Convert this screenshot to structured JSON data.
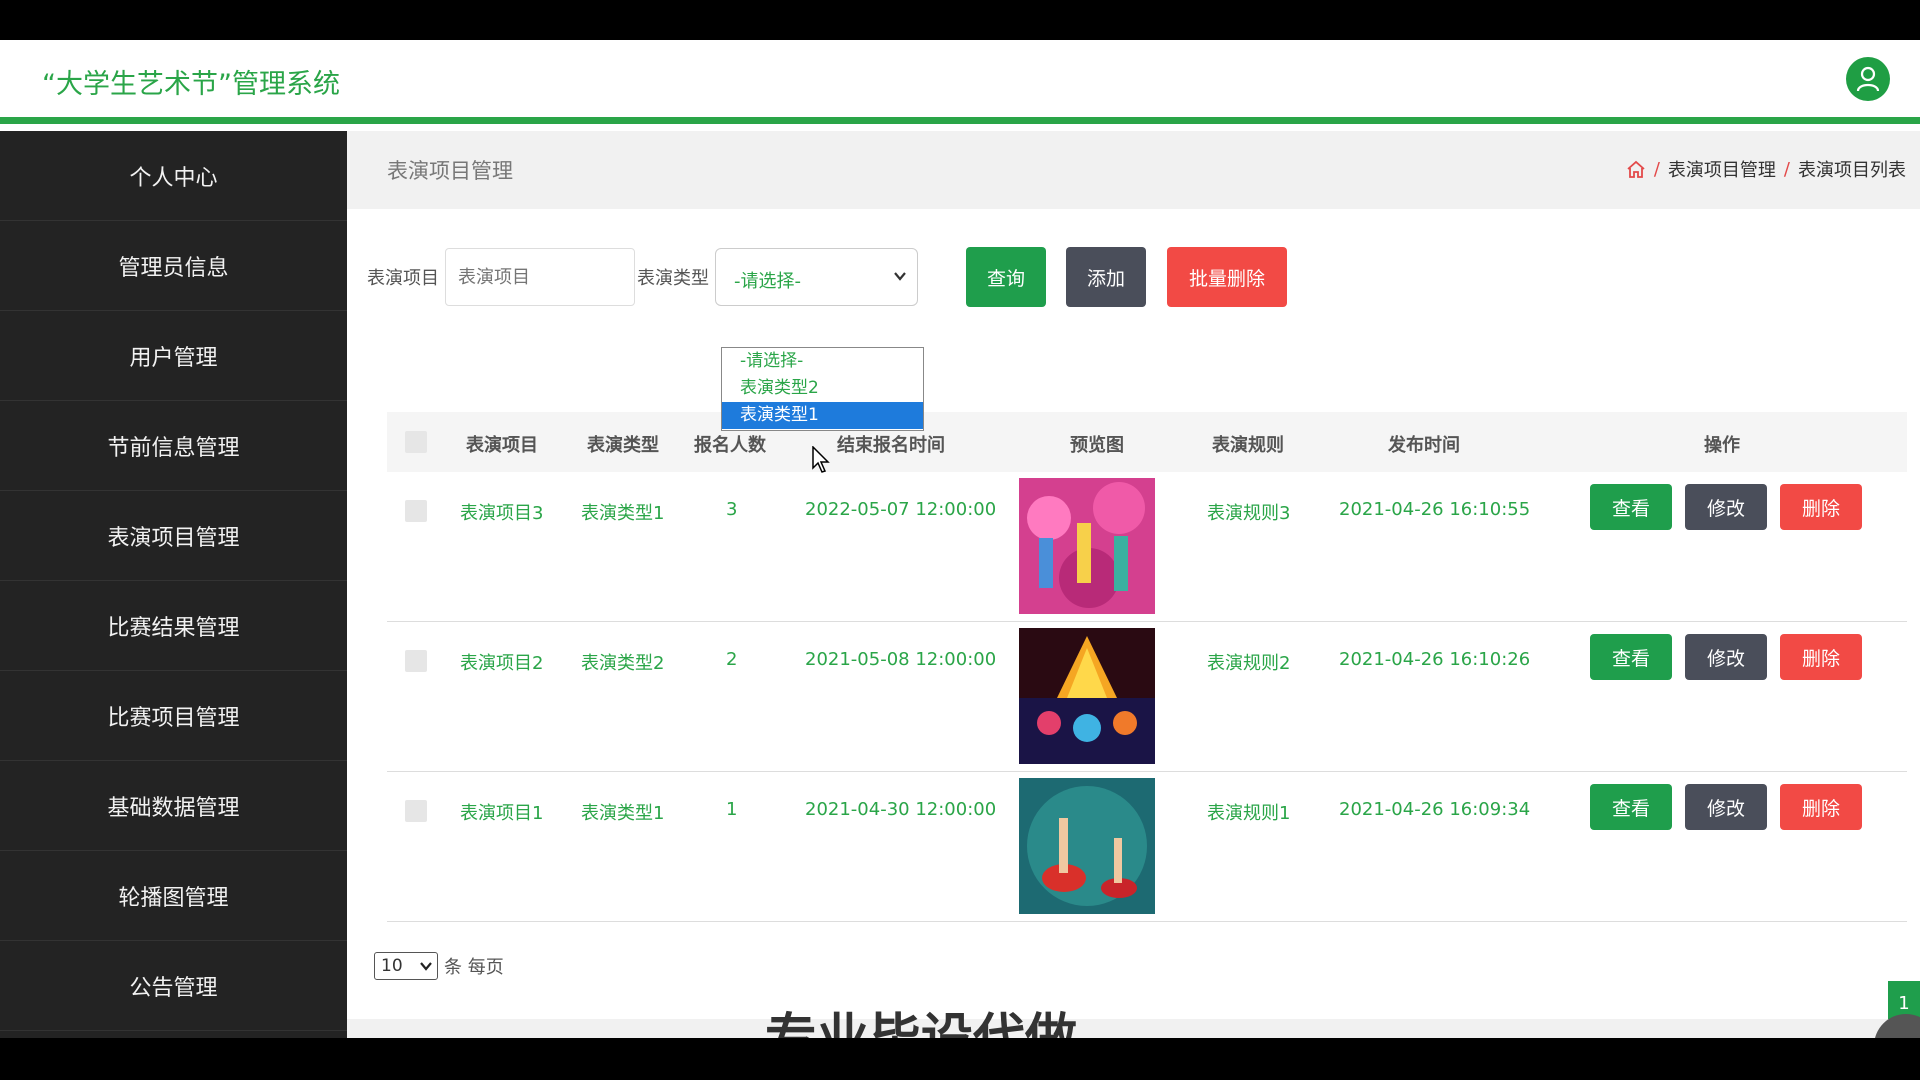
{
  "app": {
    "title": "“大学生艺术节”管理系统",
    "accent_color": "#2aa548"
  },
  "sidebar": {
    "items": [
      {
        "label": "个人中心"
      },
      {
        "label": "管理员信息"
      },
      {
        "label": "用户管理"
      },
      {
        "label": "节前信息管理"
      },
      {
        "label": "表演项目管理"
      },
      {
        "label": "比赛结果管理"
      },
      {
        "label": "比赛项目管理"
      },
      {
        "label": "基础数据管理"
      },
      {
        "label": "轮播图管理"
      },
      {
        "label": "公告管理"
      }
    ]
  },
  "page": {
    "title": "表演项目管理",
    "breadcrumb": [
      "表演项目管理",
      "表演项目列表"
    ],
    "breadcrumb_sep": "/"
  },
  "filters": {
    "project_label": "表演项目",
    "project_placeholder": "表演项目",
    "type_label": "表演类型",
    "type_selected": "-请选择-",
    "type_options": [
      "-请选择-",
      "表演类型2",
      "表演类型1"
    ],
    "type_highlighted": "表演类型1",
    "query_label": "查询",
    "add_label": "添加",
    "batch_delete_label": "批量删除"
  },
  "table": {
    "columns": [
      "表演项目",
      "表演类型",
      "报名人数",
      "结束报名时间",
      "预览图",
      "表演规则",
      "发布时间",
      "操作"
    ],
    "rows": [
      {
        "project": "表演项目3",
        "type": "表演类型1",
        "count": "3",
        "end_time": "2022-05-07 12:00:00",
        "rule": "表演规则3",
        "publish_time": "2021-04-26 16:10:55"
      },
      {
        "project": "表演项目2",
        "type": "表演类型2",
        "count": "2",
        "end_time": "2021-05-08 12:00:00",
        "rule": "表演规则2",
        "publish_time": "2021-04-26 16:10:26"
      },
      {
        "project": "表演项目1",
        "type": "表演类型1",
        "count": "1",
        "end_time": "2021-04-30 12:00:00",
        "rule": "表演规则1",
        "publish_time": "2021-04-26 16:09:34"
      }
    ],
    "view_label": "查看",
    "edit_label": "修改",
    "delete_label": "删除"
  },
  "pagination": {
    "page_size": "10",
    "unit_label": "条 每页",
    "current_page": "1"
  },
  "watermark": "专业毕设代做"
}
